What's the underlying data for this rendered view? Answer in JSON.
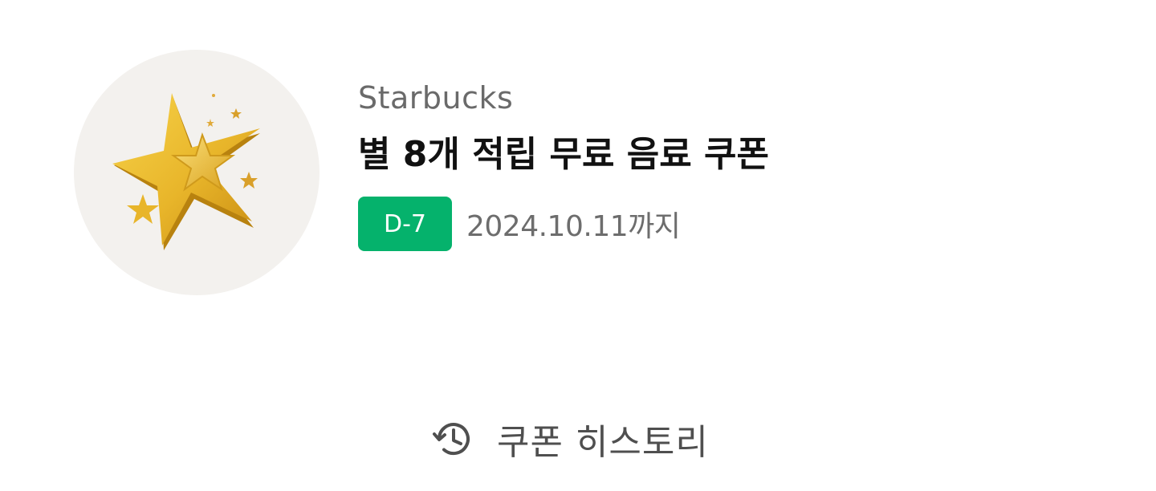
{
  "coupon": {
    "brand": "Starbucks",
    "title": "별 8개 적립 무료 음료 쿠폰",
    "dday": "D-7",
    "expiry": "2024.10.11까지",
    "image_icon": "gold-star-icon",
    "badge_color": "#05b26c",
    "thumb_bg_color": "#f3f1ee"
  },
  "history": {
    "label": "쿠폰 히스토리",
    "icon": "history-clock-icon"
  }
}
